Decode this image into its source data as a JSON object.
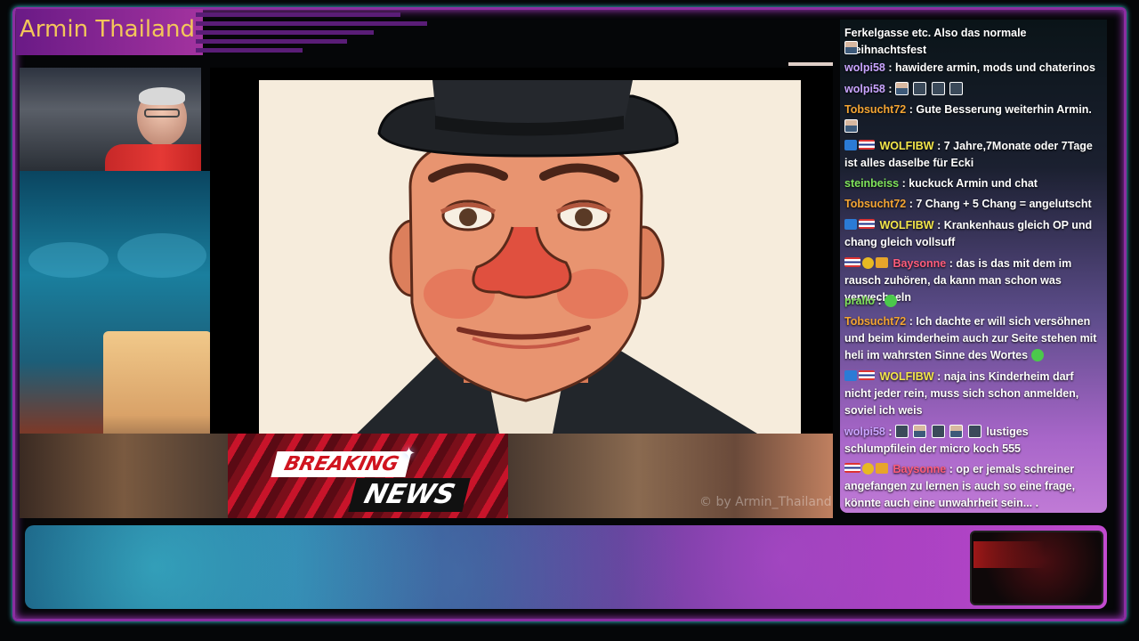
{
  "stream": {
    "title": "Armin Thailand",
    "watermark": "© by Armin_Thailand"
  },
  "breaking_news": {
    "line1": "BREAKING",
    "line2": "NEWS"
  },
  "chat": {
    "messages": [
      {
        "user": "",
        "text": "Ferkelgasse etc. Also das normale Weihnachtsfest",
        "color": "#ffffff"
      },
      {
        "user": "wolpi58",
        "text": ": hawidere armin, mods und chaterinos",
        "color": "#c9a4ff"
      },
      {
        "user": "wolpi58",
        "text": ":",
        "color": "#c9a4ff"
      },
      {
        "user": "Tobsucht72",
        "text": ": Gute Besserung weiterhin Armin.",
        "color": "#f4a533"
      },
      {
        "user": "WOLFIBW",
        "text": ": 7 Jahre,7Monate oder 7Tage ist alles daselbe für Ecki",
        "color": "#f3e64a"
      },
      {
        "user": "steinbeiss",
        "text": ": kuckuck Armin und chat",
        "color": "#7fe35a"
      },
      {
        "user": "Tobsucht72",
        "text": ": 7 Chang + 5 Chang = angelutscht",
        "color": "#f4a533"
      },
      {
        "user": "WOLFIBW",
        "text": ": Krankenhaus gleich OP und chang gleich vollsuff",
        "color": "#f3e64a"
      },
      {
        "user": "Baysonne",
        "text": ": das is das mit dem im rausch zuhören, da kann man schon was verwechseln",
        "color": "#ff5c7a"
      },
      {
        "user": "prallo",
        "text": ":",
        "color": "#7fe35a"
      },
      {
        "user": "Tobsucht72",
        "text": ": Ich dachte er will sich versöhnen und beim kimderheim auch zur Seite stehen mit heli im wahrsten Sinne des Wortes",
        "color": "#f4a533"
      },
      {
        "user": "WOLFIBW",
        "text": ": naja ins Kinderheim darf nicht jeder rein, muss sich schon anmelden, soviel ich weis",
        "color": "#f3e64a"
      },
      {
        "user": "wolpi58",
        "text": ":",
        "color": "#c9a4ff"
      },
      {
        "user": "",
        "text": "lustiges schlumpfilein der micro koch 555",
        "color": "#ffffff"
      },
      {
        "user": "Baysonne",
        "text": ": op er jemals schreiner angefangen zu lernen is auch so eine frage, könnte auch eine unwahrheit sein... .",
        "color": "#ff5c7a"
      }
    ]
  },
  "icons": {
    "user_avatar": "avatar-icon",
    "flag": "thai-flag-icon",
    "badge": "broadcaster-badge-icon",
    "mod": "mod-badge-icon",
    "emote": "emote-icon",
    "spark": "spark-icon"
  },
  "colors": {
    "frame": "#8a2ea0",
    "title": "#f3c65a",
    "breaking_red": "#c8142a"
  }
}
